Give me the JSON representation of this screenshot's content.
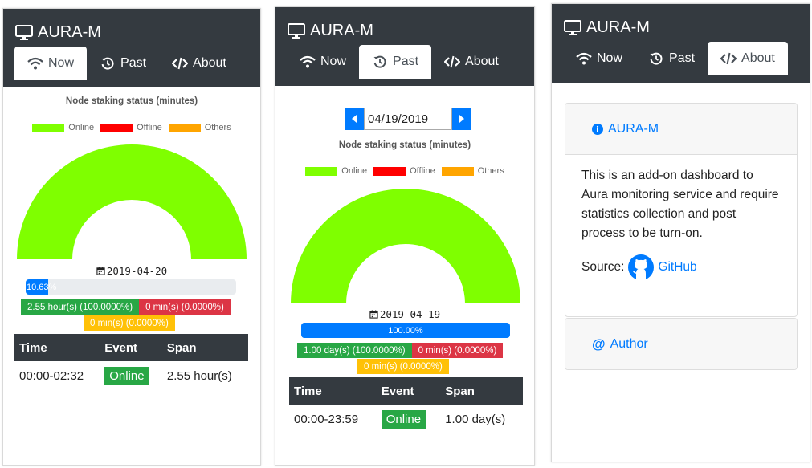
{
  "app": {
    "title": "AURA-M"
  },
  "tabs": {
    "now": "Now",
    "past": "Past",
    "about": "About"
  },
  "colors": {
    "online": "#7fff00",
    "offline": "#ff0000",
    "others": "#ffa500",
    "header": "#343a40",
    "primary": "#007bff"
  },
  "legend": {
    "online": "Online",
    "offline": "Offline",
    "others": "Others"
  },
  "now": {
    "chart_title": "Node staking status (minutes)",
    "date": "2019-04-20",
    "progress": {
      "value": 10.63,
      "label": "10.63%"
    },
    "badges": {
      "online": "2.55 hour(s) (100.0000%)",
      "offline": "0 min(s) (0.0000%)",
      "others": "0 min(s) (0.0000%)"
    },
    "table": {
      "headers": [
        "Time",
        "Event",
        "Span"
      ],
      "rows": [
        {
          "time": "00:00-02:32",
          "event": "Online",
          "span": "2.55 hour(s)"
        }
      ]
    }
  },
  "past": {
    "date_input": "04/19/2019",
    "chart_title": "Node staking status (minutes)",
    "date": "2019-04-19",
    "progress": {
      "value": 100,
      "label": "100.00%"
    },
    "badges": {
      "online": "1.00 day(s) (100.0000%)",
      "offline": "0 min(s) (0.0000%)",
      "others": "0 min(s) (0.0000%)"
    },
    "table": {
      "headers": [
        "Time",
        "Event",
        "Span"
      ],
      "rows": [
        {
          "time": "00:00-23:59",
          "event": "Online",
          "span": "1.00 day(s)"
        }
      ]
    }
  },
  "about": {
    "card1_title": "AURA-M",
    "description": "This is an add-on dashboard to Aura monitoring service and require statistics collection and post process to be turn-on.",
    "source_label": "Source:",
    "source_link": "GitHub",
    "card2_title": "Author"
  },
  "chart_data": [
    {
      "type": "pie",
      "title": "Node staking status (minutes)",
      "categories": [
        "Online",
        "Offline",
        "Others"
      ],
      "values": [
        153,
        0,
        0
      ],
      "legend": "top"
    },
    {
      "type": "pie",
      "title": "Node staking status (minutes)",
      "categories": [
        "Online",
        "Offline",
        "Others"
      ],
      "values": [
        1439,
        0,
        0
      ],
      "legend": "top"
    }
  ]
}
